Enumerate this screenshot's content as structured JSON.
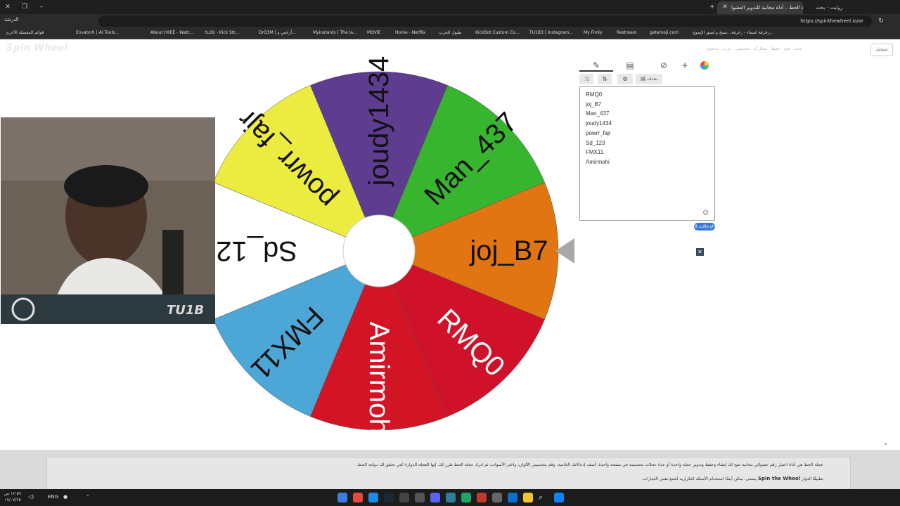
{
  "browser": {
    "active_tab_title": "عجلة الحظ – أداة مجانية للتدوير العشوا",
    "other_tab_title": "روليت - بحث",
    "url": "https://spinthewheel.io/ar",
    "profile_label": "الدرشة",
    "bookmarks": [
      "Envato® | AI Tools...",
      "About HIIEE - Watc...",
      "tu1b - Kick Str...",
      "DrO3M | أرخص و...",
      "Myinstants | The la...",
      "MOVIE",
      "Home - Netflix",
      "طبول الحرب",
      "KickBot Custom Co...",
      "TU1B3 | Instagram...",
      "My Fimly",
      "Restream",
      "getemoji.com",
      "زخرفة اسماء - زخرفة...",
      "نسخ و لصق الإيموج..."
    ],
    "other_bookmarks_label": "قوائم المفضلة الأخرى"
  },
  "site": {
    "logo": "Spin Wheel",
    "sign_in": "تسجيل",
    "nav_items": [
      "جديد",
      "فتح",
      "حفظ",
      "مشاركة",
      "تخصيص",
      "عربي",
      "مدفوع"
    ]
  },
  "wheel": {
    "segments": [
      {
        "label": "joj_B7",
        "color": "#e07512"
      },
      {
        "label": "RMQ0",
        "color": "#d0112a"
      },
      {
        "label": "Amirmohi",
        "color": "#d21425"
      },
      {
        "label": "FMX11",
        "color": "#4ca6d6"
      },
      {
        "label": "Sd_123",
        "color": "#ffffff"
      },
      {
        "label": "powrr_fajr",
        "color": "#ebeb40"
      },
      {
        "label": "joudy1434",
        "color": "#5e3c8f"
      },
      {
        "label": "Man_437",
        "color": "#38b52f"
      }
    ]
  },
  "panel": {
    "tabs": [
      {
        "name": "edit",
        "icon": "✎"
      },
      {
        "name": "results",
        "icon": "▤"
      },
      {
        "name": "hide",
        "icon": "⊘"
      },
      {
        "name": "add",
        "icon": "+"
      }
    ],
    "buttons": {
      "shuffle": "⤨",
      "sort": "⇅",
      "settings": "⚙",
      "images": "🖼 بحذف"
    },
    "entries": [
      "RMQ0",
      "joj_B7",
      "Man_437",
      "joudy1434",
      "powrr_fajr",
      "Sd_123",
      "FMX11",
      "Amirmohi"
    ],
    "count_label": "الإدخالات 8",
    "emoji_icon": "☺",
    "close_icon": "✕"
  },
  "footer": {
    "line1": "عجلة الحظ هي أداة اختيار رقم عشوائي مجانية تتيح لك إنشاء وحفظ وتدوير عجلة واحدة أو عدة عجلات مخصصة في صفحة واحدة. أضف إدخالاتك الخاصة، وقم بتخصيص الألوان، واختر الأصوات، ثم اترك عجلة الحظ تقرر لك. إنها العجلة الدوارة التي تحقق لك دوامة الحظ.",
    "line2_prefix": "تطبيقًا الدوار",
    "line2_bold": "Spin the Wheel",
    "line2_suffix": "يسمى. يمكن أيضًا استخدام الأسئلة التكرارية لجمع نفس الخيارات."
  },
  "taskbar": {
    "time": "١٢:٥٧ ص",
    "date": "١٧/٠٧/٢٥",
    "lang": "ENG"
  }
}
